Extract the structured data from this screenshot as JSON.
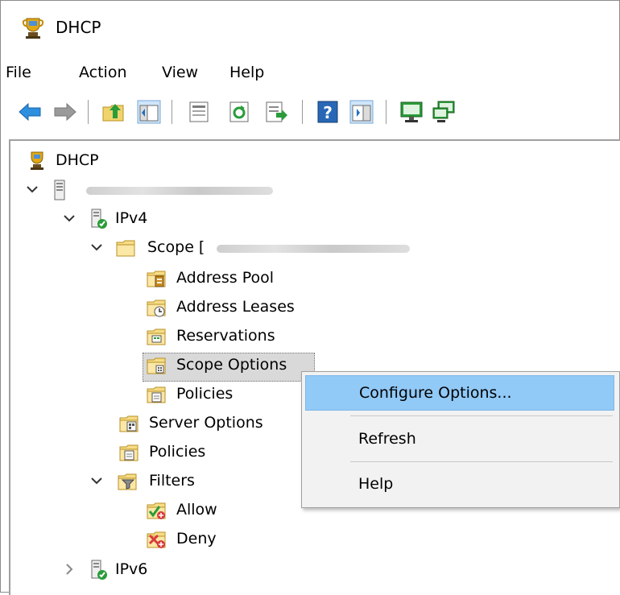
{
  "window": {
    "title": "DHCP",
    "icon": "dhcp-trophy-icon"
  },
  "menu": [
    "File",
    "Action",
    "View",
    "Help"
  ],
  "toolbar": [
    "back-arrow-icon",
    "forward-arrow-icon",
    "up-folder-icon",
    "show-hide-console-tree-icon",
    "properties-icon",
    "refresh-icon",
    "export-list-icon",
    "help-icon",
    "show-hide-action-pane-icon",
    "monitor-server-icon",
    "monitor-network-icon"
  ],
  "tree": {
    "root": "DHCP",
    "server": "",
    "ipv4": "IPv4",
    "scope": "Scope [",
    "address_pool": "Address Pool",
    "address_leases": "Address Leases",
    "reservations": "Reservations",
    "scope_options": "Scope Options",
    "scope_policies": "Policies",
    "server_options": "Server Options",
    "policies": "Policies",
    "filters": "Filters",
    "allow": "Allow",
    "deny": "Deny",
    "ipv6": "IPv6"
  },
  "context_menu": {
    "configure": "Configure Options...",
    "refresh": "Refresh",
    "help": "Help"
  },
  "colors": {
    "menu_highlight": "#91c9f7",
    "selection": "#d9d9d9"
  }
}
